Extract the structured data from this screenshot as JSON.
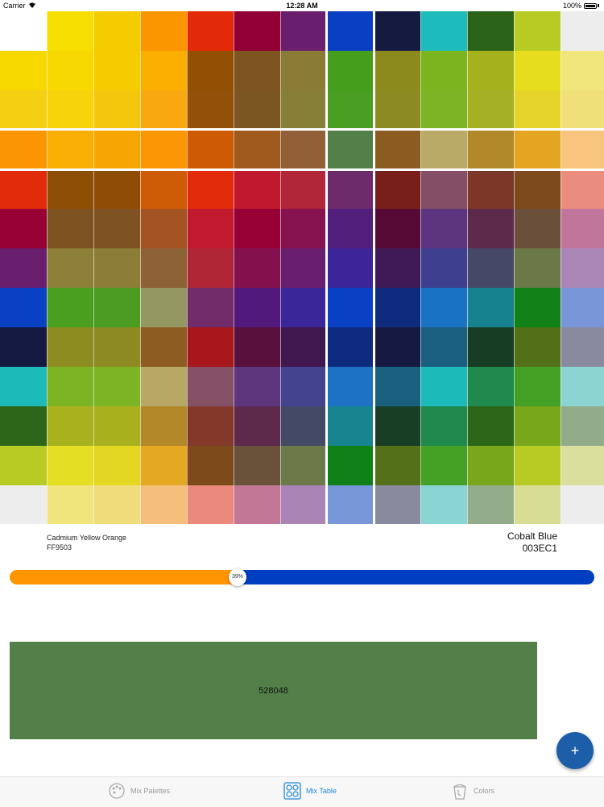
{
  "status_bar": {
    "carrier": "Carrier",
    "time": "12:28 AM",
    "battery": "100%"
  },
  "mix_table": {
    "cells": [
      [
        "#FFFFFF",
        "#F6DE00",
        "#F4CC00",
        "#FB9500",
        "#E22A08",
        "#930035",
        "#6A1E6E",
        "#0A3FC4",
        "#151A41",
        "#1DBBBB",
        "#2B6419",
        "#B8CB24",
        "#EDEDED"
      ],
      [
        "#F7D900",
        "#F7D800",
        "#F5CC00",
        "#FAAF00",
        "#934F04",
        "#7E5520",
        "#8A7C37",
        "#459E1C",
        "#8C8A1D",
        "#7CB420",
        "#A5B21E",
        "#E6DD1E",
        "#F0E67B"
      ],
      [
        "#F4CF12",
        "#F6D30B",
        "#F5C70C",
        "#F9A90F",
        "#925008",
        "#7B5623",
        "#877E38",
        "#4A9E22",
        "#8C8B22",
        "#7CB425",
        "#A6B024",
        "#E6D42B",
        "#F0E07A"
      ],
      [
        "#FB9503",
        "#F9AE04",
        "#F7A503",
        "#FB9604",
        "#CF5A04",
        "#A15A1E",
        "#926037",
        "#528048",
        "#8C5B21",
        "#BAAA67",
        "#B1882A",
        "#E4A523",
        "#F7C57D"
      ],
      [
        "#E22B0B",
        "#8F4E06",
        "#8F4C06",
        "#CE5B06",
        "#E22B0B",
        "#C0192E",
        "#B12638",
        "#6D2A6A",
        "#791F1B",
        "#844E67",
        "#7C3728",
        "#7C4A1C",
        "#EB8D7E"
      ],
      [
        "#960035",
        "#7E5321",
        "#7E5222",
        "#A45422",
        "#C2192E",
        "#960035",
        "#86134F",
        "#521F7D",
        "#560A35",
        "#5D357E",
        "#5E2A4B",
        "#6A503A",
        "#C0769A"
      ],
      [
        "#6A1E6E",
        "#8C7F37",
        "#8C7E37",
        "#8C6236",
        "#B02637",
        "#82114E",
        "#6A1E6E",
        "#3C2598",
        "#401A57",
        "#3F3F90",
        "#454866",
        "#6B7948",
        "#AA86B6"
      ],
      [
        "#0A40C4",
        "#4A9E20",
        "#4B9C20",
        "#959762",
        "#722C69",
        "#52197D",
        "#3A2698",
        "#0A40C4",
        "#0E2B7E",
        "#1A72C5",
        "#168290",
        "#118118",
        "#7996D8"
      ],
      [
        "#151A42",
        "#8C8C20",
        "#8C8A21",
        "#8C5C20",
        "#A8171B",
        "#58103C",
        "#40174E",
        "#0E2B80",
        "#161A42",
        "#1A5F7E",
        "#173E24",
        "#527018",
        "#898A9F"
      ],
      [
        "#1DBABA",
        "#7CB424",
        "#7CB424",
        "#B8A866",
        "#865067",
        "#5E367E",
        "#43438E",
        "#1D72C5",
        "#1A607F",
        "#1DBABA",
        "#1F8A4C",
        "#45A125",
        "#8CD4D1"
      ],
      [
        "#2B6619",
        "#A7B21E",
        "#A7B11E",
        "#B28829",
        "#833829",
        "#5D2A4B",
        "#444A66",
        "#17848F",
        "#183F25",
        "#1F8A4C",
        "#2B6619",
        "#78A71C",
        "#92AB89"
      ],
      [
        "#B8CB24",
        "#E4DF24",
        "#E4D724",
        "#E4A823",
        "#7D4A1C",
        "#6A513A",
        "#6C7949",
        "#108119",
        "#547018",
        "#45A126",
        "#78A71C",
        "#B8CB24",
        "#DADF9E"
      ],
      [
        "#EDEDED",
        "#F0E57C",
        "#F0DC7B",
        "#F3BF7A",
        "#EB8A7C",
        "#C37797",
        "#AA84B5",
        "#7897D8",
        "#8A8A9F",
        "#8BD4D4",
        "#93AC8A",
        "#D8DD96",
        "#EDEDED"
      ]
    ]
  },
  "selection": {
    "left_name": "Cadmium Yellow Orange",
    "left_hex": "FF9503",
    "right_name": "Cobalt Blue",
    "right_hex": "003EC1"
  },
  "slider": {
    "value_percent": 39,
    "label": "39%",
    "left_color": "#FF9503",
    "right_color": "#003EC1"
  },
  "result": {
    "hex": "528048",
    "color": "#528048"
  },
  "fab": {
    "label": "+",
    "color": "#1C5FA8"
  },
  "tabs": [
    {
      "label": "Mix Palettes",
      "icon": "palette-icon",
      "active": false
    },
    {
      "label": "Mix Table",
      "icon": "grid-icon",
      "active": true
    },
    {
      "label": "Colors",
      "icon": "paint-bucket-icon",
      "active": false
    }
  ]
}
